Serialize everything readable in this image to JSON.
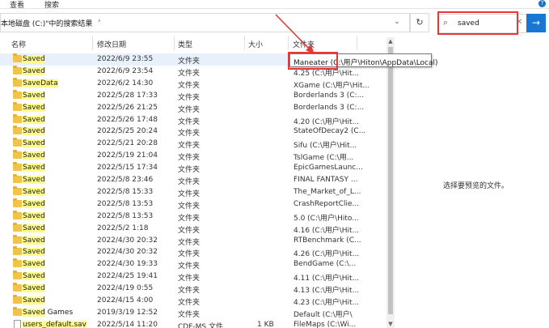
{
  "ribbon": {
    "tab_view": "查看",
    "tab_search": "搜索"
  },
  "address": {
    "crumb": "本地磁盘 (C:)\"中的搜索结果",
    "sep": "›",
    "dropdown": "⌄",
    "refresh": "↻"
  },
  "search": {
    "value": "saved",
    "clear": "✕",
    "go": "→"
  },
  "columns": {
    "name": "名称",
    "date": "修改日期",
    "type": "类型",
    "size": "大小",
    "folder": "文件夹"
  },
  "rows": [
    {
      "name": "Saved",
      "suffix": "",
      "date": "2022/6/9 23:55",
      "type": "文件夹",
      "size": "",
      "folder": ""
    },
    {
      "name": "Saved",
      "suffix": "",
      "date": "2022/6/9 23:54",
      "type": "文件夹",
      "size": "",
      "folder": "4.25 (C:\\用户\\Hit..."
    },
    {
      "name": "SaveData",
      "suffix": "",
      "date": "2022/6/2 14:30",
      "type": "文件夹",
      "size": "",
      "folder": "XGame (C:\\用户\\Hit..."
    },
    {
      "name": "Saved",
      "suffix": "",
      "date": "2022/5/28 17:33",
      "type": "文件夹",
      "size": "",
      "folder": "Borderlands 3 (C:..."
    },
    {
      "name": "Saved",
      "suffix": "",
      "date": "2022/5/26 21:25",
      "type": "文件夹",
      "size": "",
      "folder": "Borderlands 3 (C:..."
    },
    {
      "name": "Saved",
      "suffix": "",
      "date": "2022/5/26 17:48",
      "type": "文件夹",
      "size": "",
      "folder": "4.20 (C:\\用户\\Hit..."
    },
    {
      "name": "Saved",
      "suffix": "",
      "date": "2022/5/25 20:24",
      "type": "文件夹",
      "size": "",
      "folder": "StateOfDecay2 (C..."
    },
    {
      "name": "Saved",
      "suffix": "",
      "date": "2022/5/21 20:28",
      "type": "文件夹",
      "size": "",
      "folder": "Sifu (C:\\用户\\Hit..."
    },
    {
      "name": "Saved",
      "suffix": "",
      "date": "2022/5/19 21:04",
      "type": "文件夹",
      "size": "",
      "folder": "TslGame (C:\\用..."
    },
    {
      "name": "Saved",
      "suffix": "",
      "date": "2022/5/15 17:34",
      "type": "文件夹",
      "size": "",
      "folder": "EpicGamesLaunc..."
    },
    {
      "name": "Saved",
      "suffix": "",
      "date": "2022/5/8 23:46",
      "type": "文件夹",
      "size": "",
      "folder": "FINAL FANTASY ..."
    },
    {
      "name": "Saved",
      "suffix": "",
      "date": "2022/5/8 15:33",
      "type": "文件夹",
      "size": "",
      "folder": "The_Market_of_L..."
    },
    {
      "name": "Saved",
      "suffix": "",
      "date": "2022/5/8 13:53",
      "type": "文件夹",
      "size": "",
      "folder": "CrashReportClie..."
    },
    {
      "name": "Saved",
      "suffix": "",
      "date": "2022/5/8 13:53",
      "type": "文件夹",
      "size": "",
      "folder": "5.0 (C:\\用户\\Hito..."
    },
    {
      "name": "Saved",
      "suffix": "",
      "date": "2022/5/2 1:18",
      "type": "文件夹",
      "size": "",
      "folder": "4.16 (C:\\用户\\Hit..."
    },
    {
      "name": "Saved",
      "suffix": "",
      "date": "2022/4/30 20:32",
      "type": "文件夹",
      "size": "",
      "folder": "RTBenchmark (C..."
    },
    {
      "name": "Saved",
      "suffix": "",
      "date": "2022/4/30 20:32",
      "type": "文件夹",
      "size": "",
      "folder": "4.26 (C:\\用户\\Hit..."
    },
    {
      "name": "Saved",
      "suffix": "",
      "date": "2022/4/30 19:33",
      "type": "文件夹",
      "size": "",
      "folder": "BendGame (C:\\..."
    },
    {
      "name": "Saved",
      "suffix": "",
      "date": "2022/4/25 19:41",
      "type": "文件夹",
      "size": "",
      "folder": "4.11 (C:\\用户\\Hit..."
    },
    {
      "name": "Saved",
      "suffix": "",
      "date": "2022/4/19 0:55",
      "type": "文件夹",
      "size": "",
      "folder": "4.13 (C:\\用户\\Hit..."
    },
    {
      "name": "Saved",
      "suffix": "",
      "date": "2022/4/15 4:00",
      "type": "文件夹",
      "size": "",
      "folder": "4.23 (C:\\用户\\Hit..."
    },
    {
      "name": "Saved",
      "suffix": " Games",
      "date": "2019/3/19 12:52",
      "type": "文件夹",
      "size": "",
      "folder": "Default (C:\\用户\\"
    },
    {
      "name": "users_default.sav",
      "suffix": "",
      "date": "2022/5/14 11:20",
      "type": "CDF-MS 文件",
      "size": "1 KB",
      "folder": "FileMaps (C:\\Wi..."
    }
  ],
  "tooltip": "Maneater (C:\\用户\\Hiton\\AppData\\Local)",
  "preview": {
    "message": "选择要预览的文件。"
  },
  "colors": {
    "accent": "#1877d2",
    "highlight_box": "#e53935",
    "match_highlight": "#fffb8f",
    "folder": "#f0c34a"
  }
}
